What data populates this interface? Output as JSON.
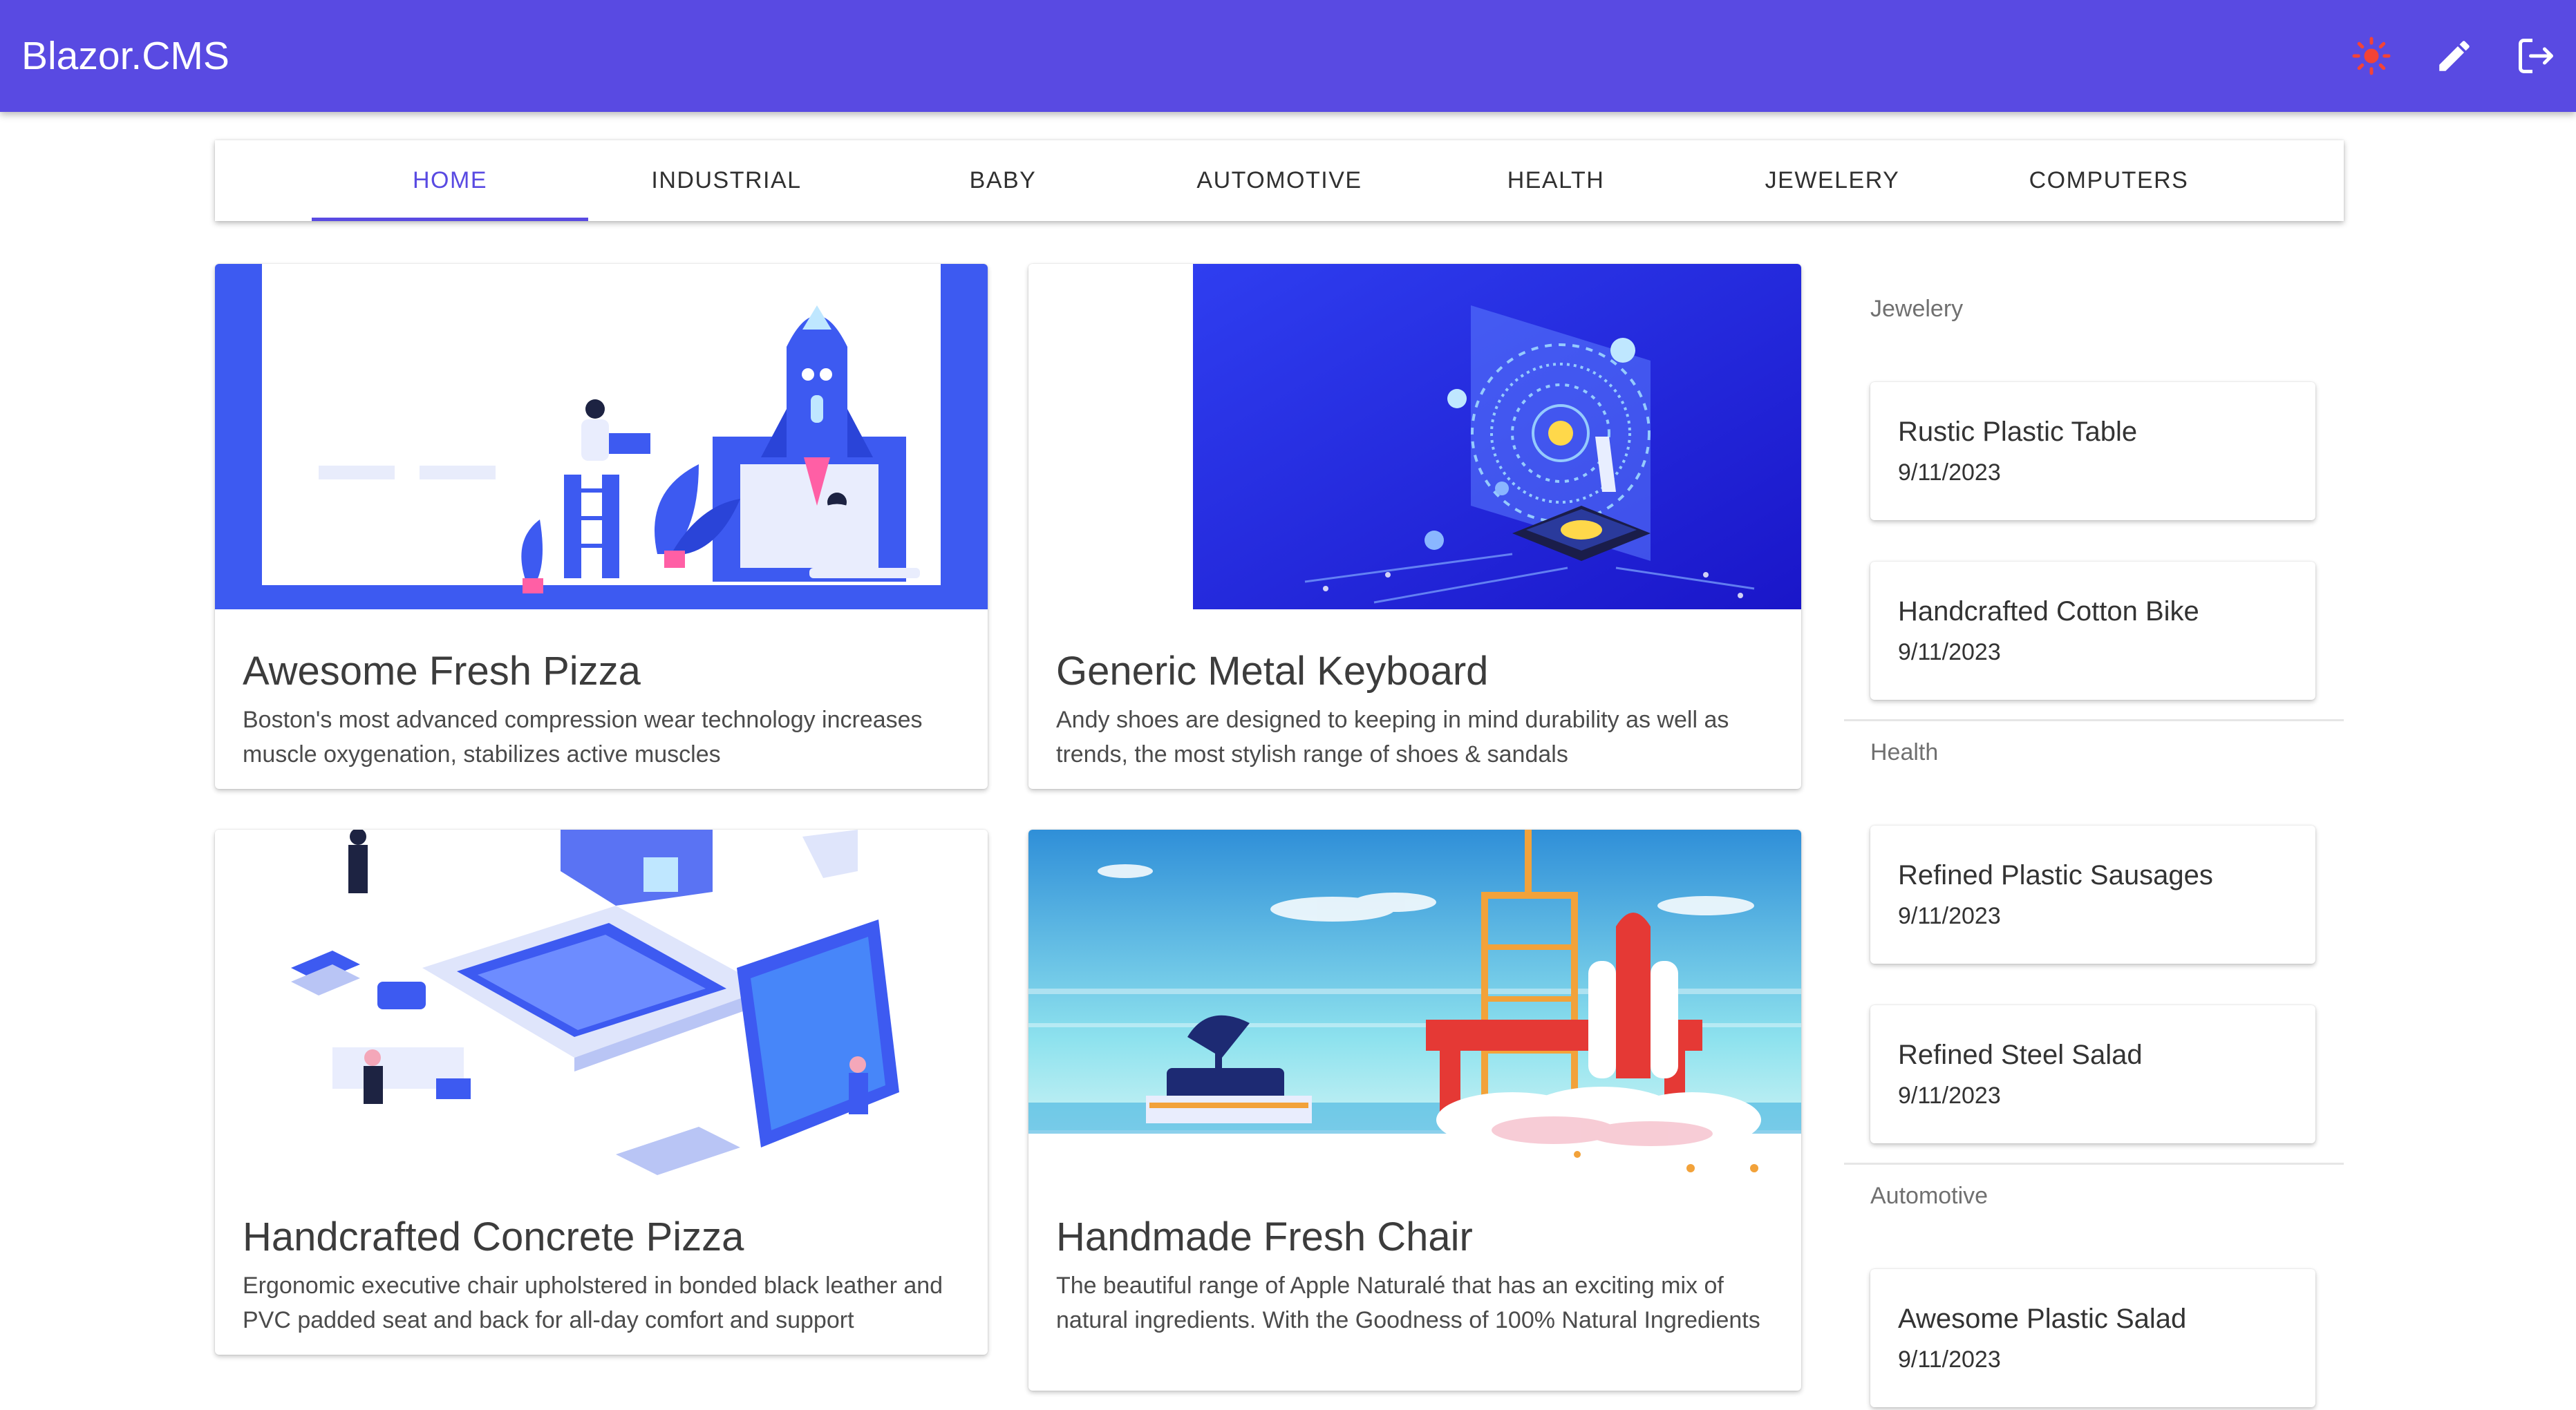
{
  "app": {
    "title": "Blazor.CMS"
  },
  "toolbar": {
    "icons": [
      "theme-toggle-icon",
      "edit-icon",
      "logout-icon"
    ],
    "accent_color": "#594ae2",
    "theme_icon_color": "#f44336"
  },
  "tabs": [
    {
      "label": "HOME",
      "active": true
    },
    {
      "label": "INDUSTRIAL"
    },
    {
      "label": "BABY"
    },
    {
      "label": "AUTOMOTIVE"
    },
    {
      "label": "HEALTH"
    },
    {
      "label": "JEWELERY"
    },
    {
      "label": "COMPUTERS"
    }
  ],
  "cards": [
    {
      "title": "Awesome Fresh Pizza",
      "description": "Boston's most advanced compression wear technology increases muscle oxygenation, stabilizes active muscles",
      "image": "rocket-launch-illustration"
    },
    {
      "title": "Generic Metal Keyboard",
      "description": "Andy shoes are designed to keeping in mind durability as well as trends, the most stylish range of shoes & sandals",
      "image": "fingerprint-chip-illustration"
    },
    {
      "title": "Handcrafted Concrete Pizza",
      "description": "Ergonomic executive chair upholstered in bonded black leather and PVC padded seat and back for all-day comfort and support",
      "image": "isometric-laptop-illustration"
    },
    {
      "title": "Handmade Fresh Chair",
      "description": "The beautiful range of Apple Naturalé that has an exciting mix of natural ingredients. With the Goodness of 100% Natural Ingredients",
      "image": "space-shuttle-launch-illustration"
    }
  ],
  "sidebar": {
    "sections": [
      {
        "label": "Jewelery",
        "items": [
          {
            "title": "Rustic Plastic Table",
            "date": "9/11/2023"
          },
          {
            "title": "Handcrafted Cotton Bike",
            "date": "9/11/2023"
          }
        ]
      },
      {
        "label": "Health",
        "items": [
          {
            "title": "Refined Plastic Sausages",
            "date": "9/11/2023"
          },
          {
            "title": "Refined Steel Salad",
            "date": "9/11/2023"
          }
        ]
      },
      {
        "label": "Automotive",
        "items": [
          {
            "title": "Awesome Plastic Salad",
            "date": "9/11/2023"
          }
        ]
      }
    ]
  }
}
